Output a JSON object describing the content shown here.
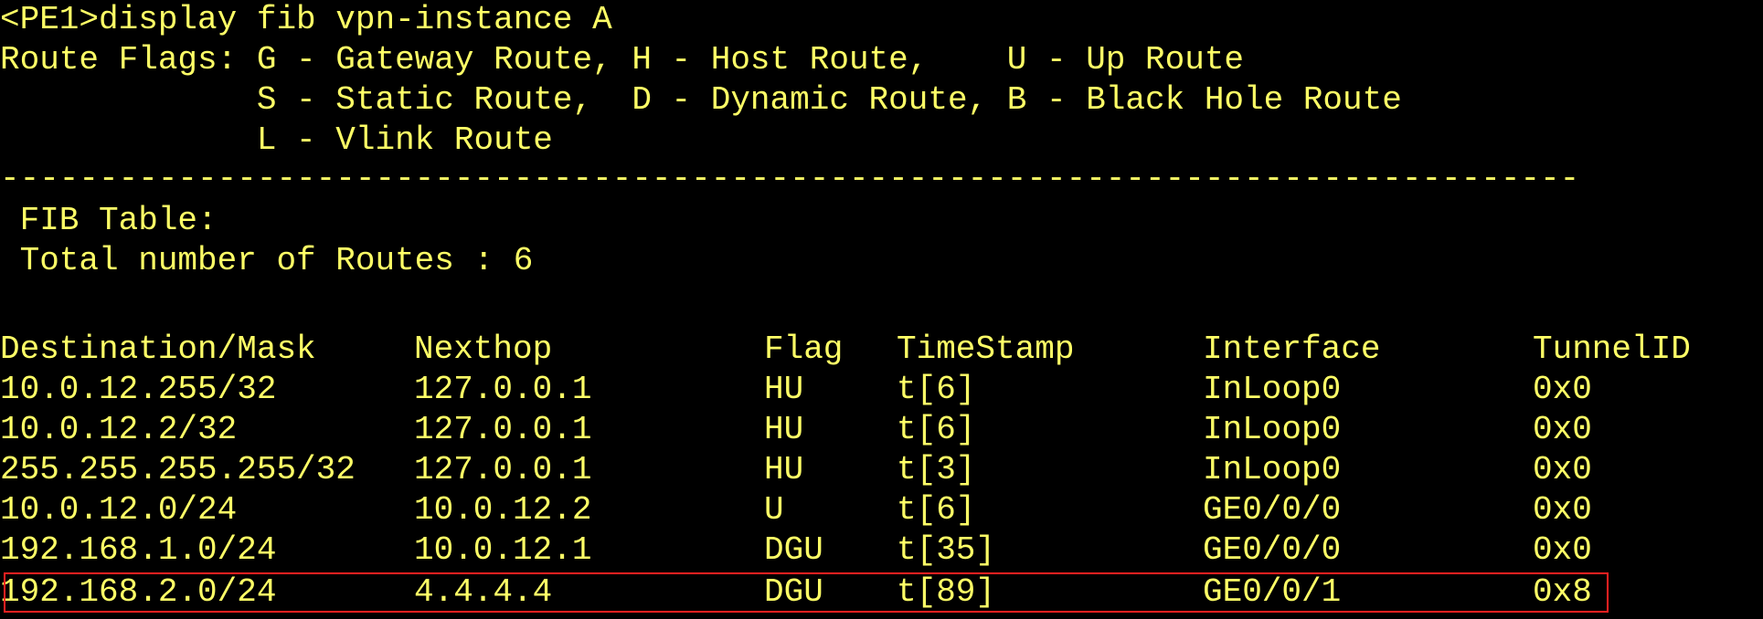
{
  "terminal": {
    "command_line": "<PE1>display fib vpn-instance A",
    "flags_line_1": "Route Flags: G - Gateway Route, H - Host Route,    U - Up Route",
    "flags_line_2": "             S - Static Route,  D - Dynamic Route, B - Black Hole Route",
    "flags_line_3": "             L - Vlink Route",
    "separator": "--------------------------------------------------------------------------------",
    "fib_table_label": " FIB Table:",
    "total_routes_line": " Total number of Routes : 6"
  },
  "table": {
    "headers": {
      "destination": "Destination/Mask",
      "nexthop": "Nexthop",
      "flag": "Flag",
      "timestamp": "TimeStamp",
      "interface": "Interface",
      "tunnel_id": "TunnelID"
    },
    "rows": [
      {
        "destination": "10.0.12.255/32",
        "nexthop": "127.0.0.1",
        "flag": "HU",
        "timestamp": "t[6]",
        "interface": "InLoop0",
        "tunnel_id": "0x0"
      },
      {
        "destination": "10.0.12.2/32",
        "nexthop": "127.0.0.1",
        "flag": "HU",
        "timestamp": "t[6]",
        "interface": "InLoop0",
        "tunnel_id": "0x0"
      },
      {
        "destination": "255.255.255.255/32",
        "nexthop": "127.0.0.1",
        "flag": "HU",
        "timestamp": "t[3]",
        "interface": "InLoop0",
        "tunnel_id": "0x0"
      },
      {
        "destination": "10.0.12.0/24",
        "nexthop": "10.0.12.2",
        "flag": "U",
        "timestamp": "t[6]",
        "interface": "GE0/0/0",
        "tunnel_id": "0x0"
      },
      {
        "destination": "192.168.1.0/24",
        "nexthop": "10.0.12.1",
        "flag": "DGU",
        "timestamp": "t[35]",
        "interface": "GE0/0/0",
        "tunnel_id": "0x0"
      },
      {
        "destination": "192.168.2.0/24",
        "nexthop": "4.4.4.4",
        "flag": "DGU",
        "timestamp": "t[89]",
        "interface": "GE0/0/1",
        "tunnel_id": "0x8"
      }
    ]
  },
  "colors": {
    "background": "#000000",
    "text": "#ffff66",
    "highlight_border": "#ff2020"
  }
}
